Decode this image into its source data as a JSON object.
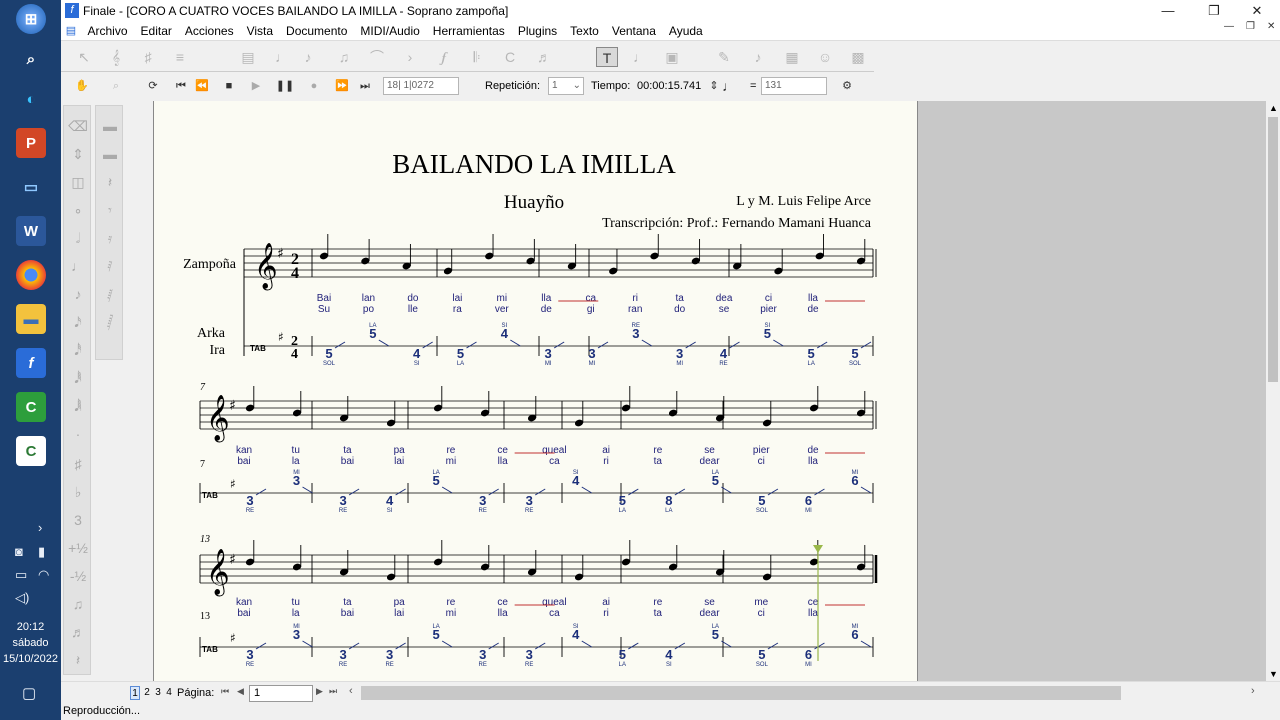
{
  "taskbar": {
    "time": "20:12",
    "day": "sábado",
    "date": "15/10/2022"
  },
  "window": {
    "title": "Finale - [CORO A CUATRO VOCES BAILANDO LA IMILLA - Soprano zampoña]"
  },
  "menu": [
    "Archivo",
    "Editar",
    "Acciones",
    "Vista",
    "Documento",
    "MIDI/Audio",
    "Herramientas",
    "Plugins",
    "Texto",
    "Ventana",
    "Ayuda"
  ],
  "playback": {
    "measure_counter": "18| 1|0272",
    "repeat_label": "Repetición:",
    "repeat_value": "1",
    "time_label": "Tiempo:",
    "time_value": "00:00:15.741",
    "tempo_value": "131",
    "equals": "="
  },
  "score": {
    "title": "BAILANDO LA IMILLA",
    "subtitle": "Huayño",
    "composer": "L y M. Luis Felipe Arce",
    "transcription": "Transcripción: Prof.: Fernando Mamani Huanca",
    "staff1": "Zampoña",
    "staff2a": "Arka",
    "staff2b": "Ira",
    "meas7": "7",
    "meas13": "13",
    "sys1_verse1": [
      "Bai",
      "lan",
      "do",
      "lai",
      "mi",
      "lla",
      "ca",
      "ri",
      "ta",
      "dea",
      "ci",
      "lla"
    ],
    "sys1_verse2": [
      "Su",
      "po",
      "lle",
      "ra",
      "ver",
      "de",
      "gi",
      "ran",
      "do",
      "se",
      "pier",
      "de"
    ],
    "sys2_verse1": [
      "kan",
      "tu",
      "ta",
      "pa",
      "re",
      "ce",
      "queal",
      "ai",
      "re",
      "se",
      "pier",
      "de"
    ],
    "sys2_verse2": [
      "bai",
      "la",
      "bai",
      "lai",
      "mi",
      "lla",
      "ca",
      "ri",
      "ta",
      "dear",
      "ci",
      "lla"
    ],
    "sys3_verse1": [
      "kan",
      "tu",
      "ta",
      "pa",
      "re",
      "ce",
      "queal",
      "ai",
      "re",
      "se",
      "me",
      "ce"
    ],
    "sys3_verse2": [
      "bai",
      "la",
      "bai",
      "lai",
      "mi",
      "lla",
      "ca",
      "ri",
      "ta",
      "dear",
      "ci",
      "lla"
    ],
    "tab_nums_1": [
      "5",
      "5",
      "4",
      "5",
      "4",
      "3",
      "3",
      "3",
      "3",
      "4",
      "5",
      "5",
      "5"
    ],
    "tab_notes_1": [
      "SOL",
      "LA",
      "SI",
      "LA",
      "SI",
      "MI",
      "MI",
      "RE",
      "MI",
      "RE",
      "SI",
      "LA",
      "SOL",
      "SOL"
    ],
    "tab_nums_2": [
      "3",
      "3",
      "3",
      "4",
      "5",
      "3",
      "3",
      "4",
      "5",
      "8",
      "5",
      "5",
      "6",
      "6"
    ],
    "tab_notes_2": [
      "RE",
      "MI",
      "RE",
      "SI",
      "LA",
      "RE",
      "RE",
      "SI",
      "LA",
      "LA",
      "LA",
      "SOL",
      "MI",
      "MI"
    ],
    "tab_nums_3": [
      "3",
      "3",
      "3",
      "3",
      "5",
      "3",
      "3",
      "4",
      "5",
      "4",
      "5",
      "5",
      "6",
      "6"
    ],
    "tab_notes_3": [
      "RE",
      "MI",
      "RE",
      "RE",
      "LA",
      "RE",
      "RE",
      "SI",
      "LA",
      "SI",
      "LA",
      "SOL",
      "MI",
      "MI"
    ]
  },
  "bottom": {
    "pages": [
      "1",
      "2",
      "3",
      "4"
    ],
    "page_label": "Página:",
    "page_value": "1"
  },
  "status": "Reproducción..."
}
